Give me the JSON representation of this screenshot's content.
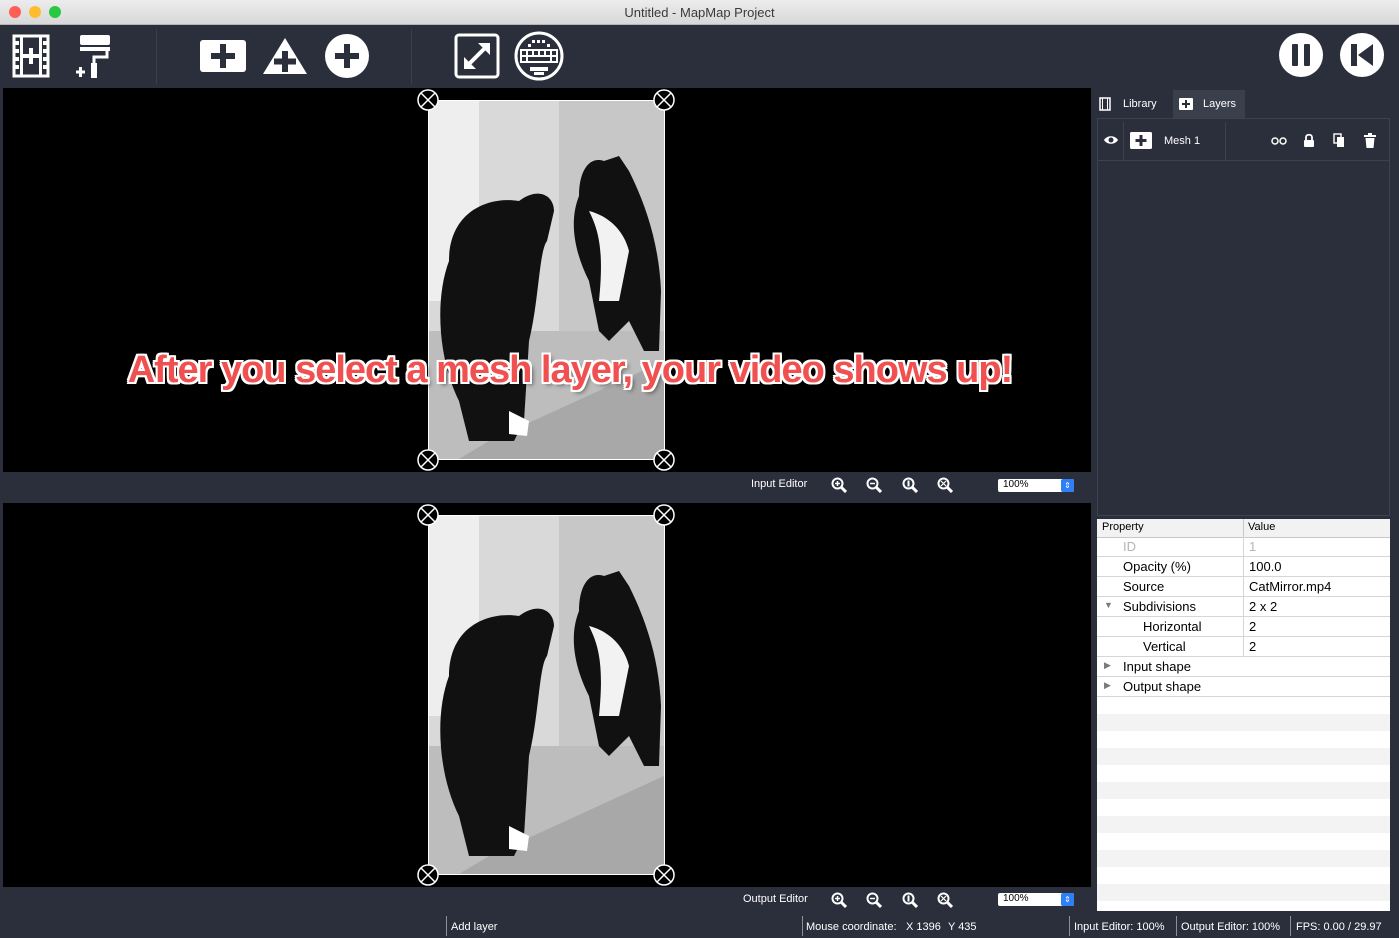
{
  "window": {
    "title": "Untitled - MapMap Project"
  },
  "toolbar": {
    "buttons": [
      {
        "name": "add-video-icon"
      },
      {
        "name": "add-paint-icon"
      },
      {
        "name": "add-mesh-icon"
      },
      {
        "name": "add-triangle-icon"
      },
      {
        "name": "add-ellipse-icon"
      },
      {
        "name": "fullscreen-icon"
      },
      {
        "name": "display-output-icon"
      },
      {
        "name": "pause-icon"
      },
      {
        "name": "rewind-icon"
      }
    ]
  },
  "input_editor": {
    "label": "Input Editor",
    "zoom": "100%"
  },
  "output_editor": {
    "label": "Output Editor",
    "zoom": "100%"
  },
  "overlay_caption": "After you select a mesh layer, your video shows up!",
  "right_panel": {
    "tabs": [
      {
        "label": "Library"
      },
      {
        "label": "Layers"
      }
    ],
    "layers": [
      {
        "name": "Mesh 1"
      }
    ],
    "properties": {
      "header": {
        "property": "Property",
        "value": "Value"
      },
      "rows": [
        {
          "name": "ID",
          "value": "1",
          "disabled": true
        },
        {
          "name": "Opacity (%)",
          "value": "100.0"
        },
        {
          "name": "Source",
          "value": "CatMirror.mp4"
        },
        {
          "name": "Subdivisions",
          "value": "2 x 2",
          "expanded": true
        },
        {
          "name": "Horizontal",
          "value": "2",
          "child": true
        },
        {
          "name": "Vertical",
          "value": "2",
          "child": true
        },
        {
          "name": "Input shape",
          "value": "",
          "collapsed": true
        },
        {
          "name": "Output shape",
          "value": "",
          "collapsed": true
        }
      ]
    }
  },
  "status_bar": {
    "message": "Add layer",
    "mouse_label": "Mouse coordinate:",
    "mouse_x": "X 1396",
    "mouse_y": "Y 435",
    "input_zoom": "Input Editor: 100%",
    "output_zoom": "Output Editor: 100%",
    "fps": "FPS: 0.00 / 29.97"
  },
  "colors": {
    "accent": "#2f7ff6",
    "panel": "#2b2f3b",
    "caption": "#f05050"
  }
}
